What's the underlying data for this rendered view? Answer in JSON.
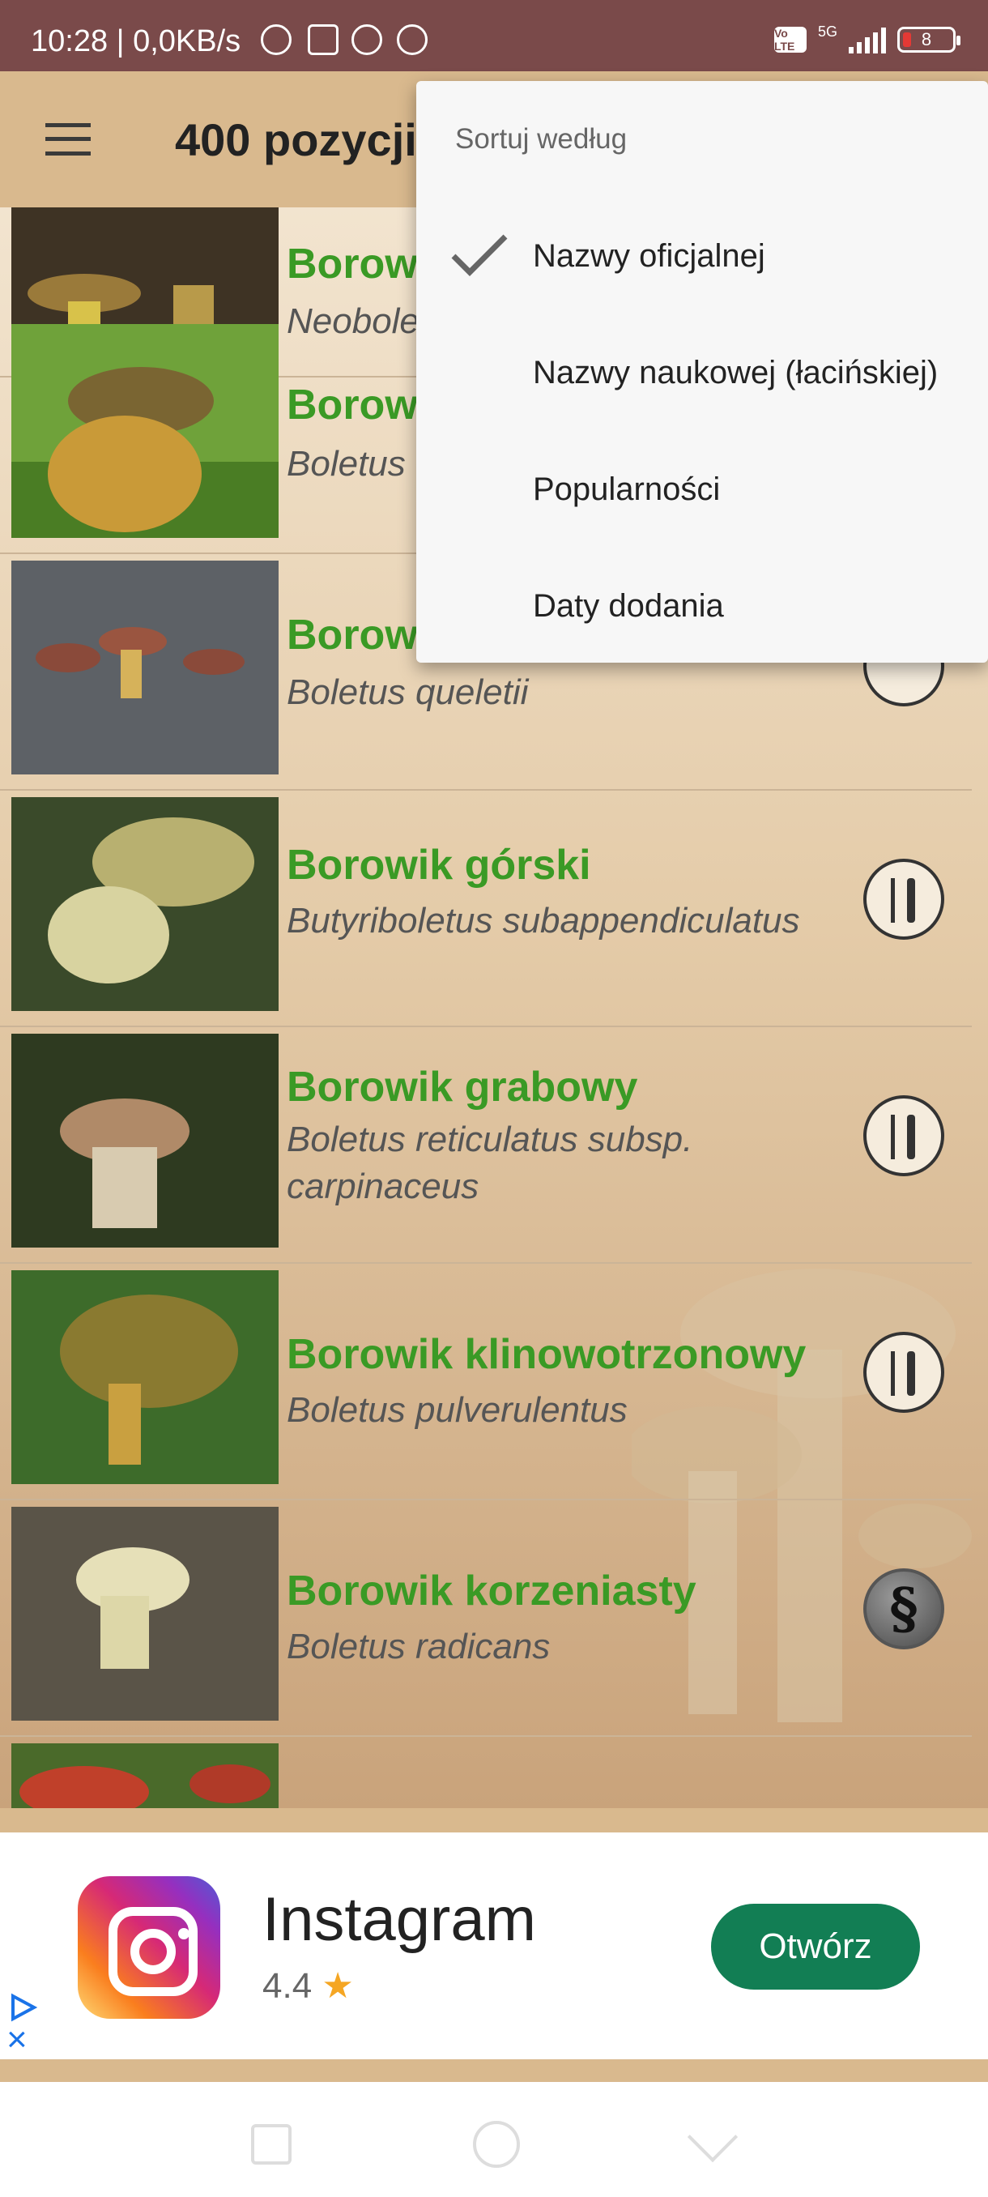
{
  "status": {
    "time": "10:28 | 0,0KB/s",
    "network": "5G",
    "volte": "Vo LTE",
    "battery": "8"
  },
  "appbar": {
    "title": "400 pozycji"
  },
  "menu": {
    "title": "Sortuj według",
    "items": [
      {
        "label": "Nazwy oficjalnej",
        "checked": true
      },
      {
        "label": "Nazwy naukowej (łacińskiej)",
        "checked": false
      },
      {
        "label": "Popularności",
        "checked": false
      },
      {
        "label": "Daty dodania",
        "checked": false
      }
    ]
  },
  "list": [
    {
      "name": "Borowik ceglastopory",
      "latin": "Neoboletus erythropus",
      "badge": "none"
    },
    {
      "name": "Borowik",
      "latin": "Boletus",
      "badge": "none"
    },
    {
      "name": "Borowik",
      "latin": "Boletus queletii",
      "badge": "edible"
    },
    {
      "name": "Borowik górski",
      "latin": "Butyriboletus subappendiculatus",
      "badge": "edible"
    },
    {
      "name": "Borowik grabowy",
      "latin": "Boletus reticulatus subsp. carpinaceus",
      "badge": "edible"
    },
    {
      "name": "Borowik klinowotrzonowy",
      "latin": "Boletus pulverulentus",
      "badge": "edible"
    },
    {
      "name": "Borowik korzeniasty",
      "latin": "Boletus radicans",
      "badge": "legal",
      "badge_symbol": "§"
    },
    {
      "name": "",
      "latin": "",
      "badge": "none"
    }
  ],
  "ad": {
    "app_name": "Instagram",
    "rating": "4.4",
    "star": "★",
    "button": "Otwórz"
  },
  "colors": {
    "status_bar": "#7a4a4a",
    "app_bar": "#d9b98e",
    "name_green": "#3a9a25",
    "ad_button": "#127e54"
  }
}
